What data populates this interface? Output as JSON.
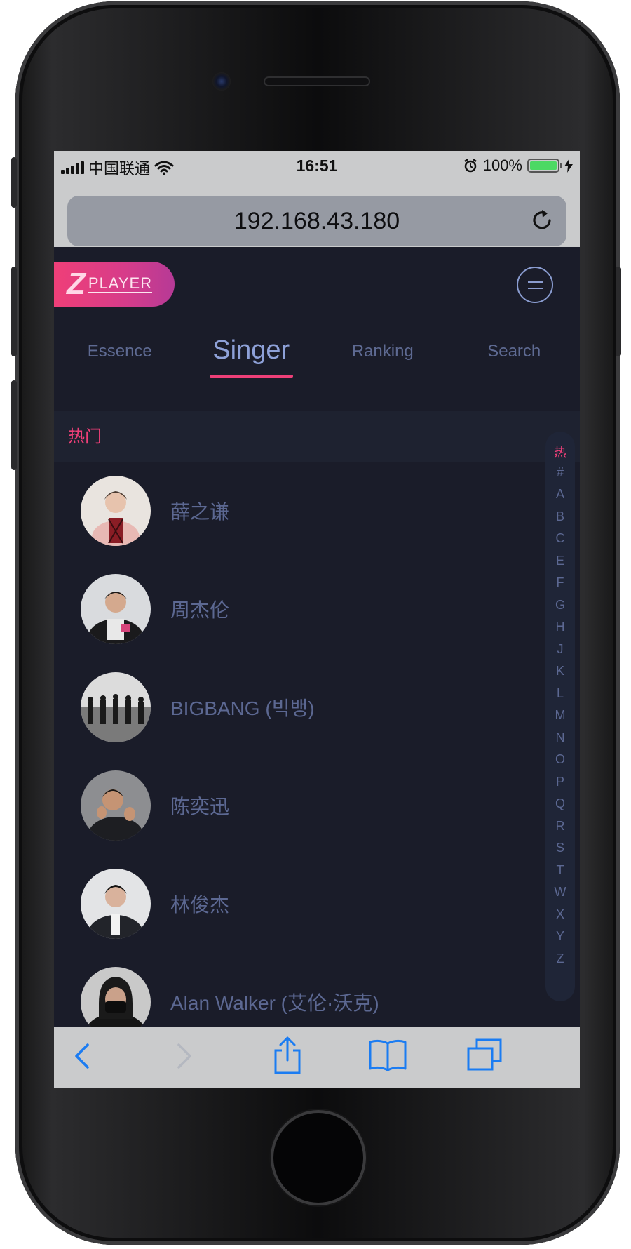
{
  "status_bar": {
    "carrier": "中国联通",
    "time": "16:51",
    "battery": "100%"
  },
  "browser": {
    "url": "192.168.43.180"
  },
  "app": {
    "logo_letter": "Z",
    "logo_text": "PLAYER",
    "tabs": [
      {
        "label": "Essence"
      },
      {
        "label": "Singer",
        "active": true
      },
      {
        "label": "Ranking"
      },
      {
        "label": "Search"
      }
    ],
    "group_title": "热门",
    "singers": [
      {
        "name": "薛之谦"
      },
      {
        "name": "周杰伦"
      },
      {
        "name": "BIGBANG (빅뱅)"
      },
      {
        "name": "陈奕迅"
      },
      {
        "name": "林俊杰"
      },
      {
        "name": "Alan Walker (艾伦·沃克)"
      }
    ],
    "index": [
      "热",
      "#",
      "A",
      "B",
      "C",
      "E",
      "F",
      "G",
      "H",
      "J",
      "K",
      "L",
      "M",
      "N",
      "O",
      "P",
      "Q",
      "R",
      "S",
      "T",
      "W",
      "X",
      "Y",
      "Z"
    ]
  },
  "colors": {
    "accent": "#ee3f78",
    "background": "#1a1c29",
    "text_muted": "#5c6892",
    "tab_active": "#8ea1d8",
    "browser_chrome": "#cacbcc",
    "toolbar_icon": "#1b7cf2"
  }
}
